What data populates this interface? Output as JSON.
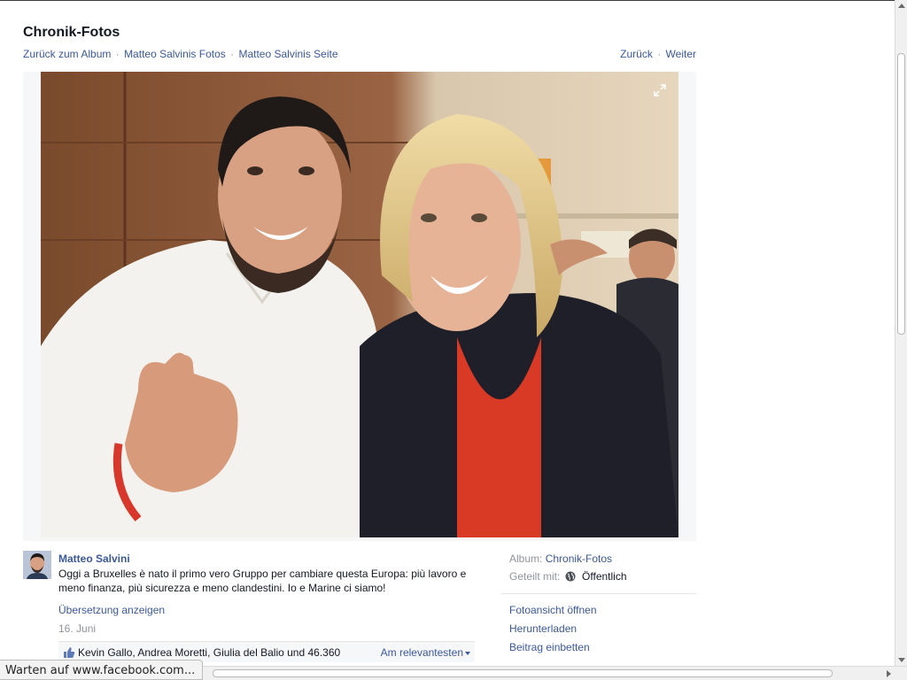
{
  "header": {
    "title": "Chronik-Fotos",
    "breadcrumbs": [
      {
        "label": "Zurück zum Album"
      },
      {
        "label": "Matteo Salvinis Fotos"
      },
      {
        "label": "Matteo Salvinis Seite"
      }
    ],
    "separator": "·",
    "nav": {
      "back": "Zurück",
      "next": "Weiter"
    }
  },
  "photo": {
    "expand_icon": "expand-icon"
  },
  "post": {
    "author": "Matteo Salvini",
    "text": "Oggi a Bruxelles è nato il primo vero Gruppo per cambiare questa Europa: più lavoro e meno finanza, più sicurezza e meno clandestini. Io e Marine ci siamo!",
    "translate": "Übersetzung anzeigen",
    "date": "16. Juni",
    "likes": "Kevin Gallo, Andrea Moretti, Giulia del Balio und 46.360",
    "sort": "Am relevantesten"
  },
  "meta": {
    "album_label": "Album:",
    "album_value": "Chronik-Fotos",
    "shared_label": "Geteilt mit:",
    "shared_value": "Öffentlich"
  },
  "actions": {
    "open_view": "Fotoansicht öffnen",
    "download": "Herunterladen",
    "embed": "Beitrag einbetten"
  },
  "status_bar": "Warten auf www.facebook.com...",
  "colors": {
    "link": "#3b5998",
    "muted": "#90949c"
  }
}
